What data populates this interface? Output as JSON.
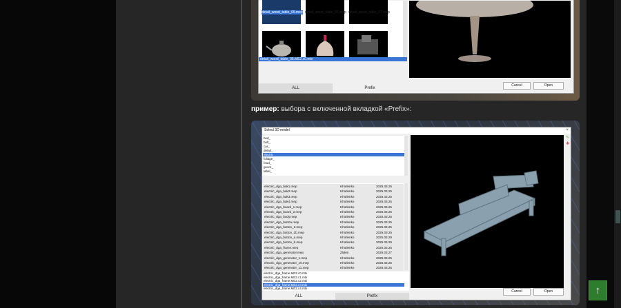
{
  "caption": {
    "bold": "пример:",
    "text": " выбора с включенной вкладкой «Prefix»:"
  },
  "screenshot1": {
    "thumb_labels": [
      "detail_wood_table_05.mep",
      "detail_wood_table_06.mep",
      "detail_wood_table_07.mep"
    ],
    "selected_file": "detail_wood_table_05.ME2.c0.mtx",
    "tabs": [
      "ALL",
      "Prefix"
    ],
    "buttons": {
      "cancel": "Cancel",
      "open": "Open"
    }
  },
  "screenshot2": {
    "title": "Select 3D model",
    "close": "×",
    "prefixes": [
      "bed_",
      "bolt_",
      "car_",
      "detail_",
      "electric",
      "foliage_",
      "food_",
      "geom_",
      "label_"
    ],
    "files": [
      {
        "name": "electric_dga_bak1.mep",
        "author": "Khotlenko",
        "date": "2025.03.25"
      },
      {
        "name": "electric_dga_bak2.mep",
        "author": "Khotlenko",
        "date": "2025.03.25"
      },
      {
        "name": "electric_dga_bak3.mep",
        "author": "Khotlenko",
        "date": "2025.03.25"
      },
      {
        "name": "electric_dga_bak4.mep",
        "author": "Khotlenko",
        "date": "2025.03.25"
      },
      {
        "name": "electric_dga_board_1.mep",
        "author": "Khotlenko",
        "date": "2025.03.25"
      },
      {
        "name": "electric_dga_board_2.mep",
        "author": "Khotlenko",
        "date": "2025.03.25"
      },
      {
        "name": "electric_dga_body.mep",
        "author": "Khotlenko",
        "date": "2025.03.25"
      },
      {
        "name": "electric_dga_button.mep",
        "author": "Khotlenko",
        "date": "2025.03.25"
      },
      {
        "name": "electric_dga_button_2.mep",
        "author": "Khotlenko",
        "date": "2025.03.25"
      },
      {
        "name": "electric_dga_button_2b.mep",
        "author": "Khotlenko",
        "date": "2025.03.25"
      },
      {
        "name": "electric_dga_button_a.mep",
        "author": "Khotlenko",
        "date": "2025.03.29"
      },
      {
        "name": "electric_dga_button_b.mep",
        "author": "Khotlenko",
        "date": "2025.03.29"
      },
      {
        "name": "electric_dga_frame.mep",
        "author": "Khotlenko",
        "date": "2025.03.25"
      },
      {
        "name": "electric_dga_generator.mep",
        "author": "Zlukin",
        "date": "2025.03.27"
      },
      {
        "name": "electric_dga_generator_1.mep",
        "author": "Khotlenko",
        "date": "2025.03.25"
      },
      {
        "name": "electric_dga_generator_10.mep",
        "author": "Khotlenko",
        "date": "2025.03.25"
      },
      {
        "name": "electric_dga_generator_11.mep",
        "author": "Khotlenko",
        "date": "2025.03.25"
      }
    ],
    "mtx_files": [
      "electric_dga_frame.ME2.c0.mtx",
      "electric_dga_frame.ME2.c1.mtx",
      "electric_dga_frame.ME2.c2.mtx",
      "electric_dga_frame.ME2.c3.mtx",
      "electric_dga_frame.ME2.c4.mtx"
    ],
    "selected_mtx_index": 3,
    "selected_prefix_index": 4,
    "tabs": [
      "ALL",
      "Prefix"
    ],
    "buttons": {
      "cancel": "Cancel",
      "open": "Open"
    }
  },
  "to_top": "↑",
  "colors": {
    "accent_green": "#2e7d2e",
    "selection": "#3875d7"
  }
}
